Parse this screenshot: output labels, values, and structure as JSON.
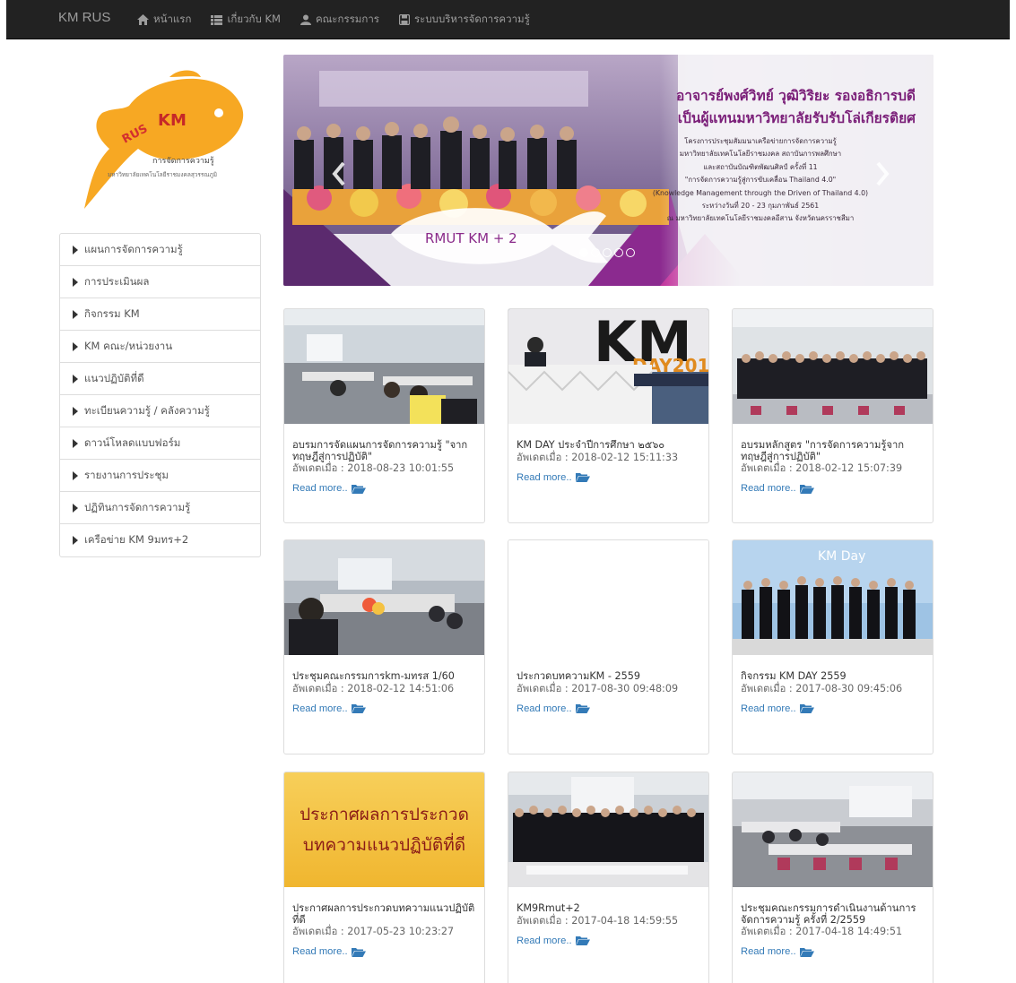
{
  "navbar": {
    "brand": "KM RUS",
    "links": [
      {
        "label": "หน้าแรก",
        "icon": "home-icon"
      },
      {
        "label": "เกี่ยวกับ KM",
        "icon": "list-icon"
      },
      {
        "label": "คณะกรรมการ",
        "icon": "user-icon"
      },
      {
        "label": "ระบบบริหารจัดการความรู้",
        "icon": "disk-icon"
      }
    ]
  },
  "logo": {
    "mark": "RUSKM",
    "title": "การจัดการความรู้",
    "subtitle": "มหาวิทยาลัยเทคโนโลยีราชมงคลสุวรรณภูมิ"
  },
  "sidebar": {
    "items": [
      {
        "label": "แผนการจัดการความรู้"
      },
      {
        "label": "การประเมินผล"
      },
      {
        "label": "กิจกรรม KM"
      },
      {
        "label": "KM คณะ/หน่วยงาน"
      },
      {
        "label": "แนวปฏิบัติที่ดี"
      },
      {
        "label": "ทะเบียนความรู้ / คลังความรู้"
      },
      {
        "label": "ดาวน์โหลดแบบฟอร์ม"
      },
      {
        "label": "รายงานการประชุม"
      },
      {
        "label": "ปฏิทินการจัดการความรู้"
      },
      {
        "label": "เครือข่าย KM 9มทร+2"
      }
    ]
  },
  "carousel": {
    "headline_1": "อาจารย์พงศ์วิทย์ วุฒิวิริยะ รองอธิการบดี",
    "headline_2": "เป็นผู้แทนมหาวิทยาลัยรับรับโล่เกียรติยศ",
    "body_lines": [
      "โครงการประชุมสัมมนาเครือข่ายการจัดการความรู้",
      "มหาวิทยาลัยเทคโนโลยีราชมงคล สถาบันการพลศึกษา",
      "และสถาบันบัณฑิตพัฒนศิลป์ ครั้งที่ 11",
      "\"การจัดการความรู้สู่การขับเคลื่อน Thailand 4.0\"",
      "(Knowledge Management through the Driven of Thailand 4.0)",
      "ระหว่างวันที่ 20 - 23 กุมภาพันธ์ 2561",
      "ณ มหาวิทยาลัยเทคโนโลยีราชมงคลอีสาน จังหวัดนครราชสีมา"
    ],
    "banner_label": "RMUT KM + 2",
    "slide_count": 5,
    "active_slide": 1
  },
  "cards": [
    {
      "title": "อบรมการจัดแผนการจัดการความรู้ \"จากทฤษฎีสู่การปฏิบัติ\"",
      "date": "อัพเดตเมื่อ : 2018-08-23 10:01:55",
      "read_more": "Read more..",
      "image": "meeting-room-photo"
    },
    {
      "title": "KM DAY ประจำปีการศึกษา ๒๕๖๐",
      "date": "อัพเดตเมื่อ : 2018-02-12 15:11:33",
      "read_more": "Read more..",
      "image": "km-day-2018-photo"
    },
    {
      "title": "อบรมหลักสูตร \"การจัดการความรู้จากทฤษฎีสู่การปฏิบัติ\"",
      "date": "อัพเดตเมื่อ : 2018-02-12 15:07:39",
      "read_more": "Read more..",
      "image": "group-photo"
    },
    {
      "title": "ประชุมคณะกรรมการkm-มทรส 1/60",
      "date": "อัพเดตเมื่อ : 2018-02-12 14:51:06",
      "read_more": "Read more..",
      "image": "meeting-photo"
    },
    {
      "title": "ประกวดบทความKM - 2559",
      "date": "อัพเดตเมื่อ : 2017-08-30 09:48:09",
      "read_more": "Read more..",
      "image": ""
    },
    {
      "title": "กิจกรรม KM DAY 2559",
      "date": "อัพเดตเมื่อ : 2017-08-30 09:45:06",
      "read_more": "Read more..",
      "image": "km-day-group-photo"
    },
    {
      "title": "ประกาศผลการประกวดบทความแนวปฏิบัติที่ดี",
      "date": "อัพเดตเมื่อ : 2017-05-23 10:23:27",
      "read_more": "Read more..",
      "image": "announcement-banner",
      "banner_text_1": "ประกาศผลการประกวด",
      "banner_text_2": "บทความแนวปฏิบัติที่ดี"
    },
    {
      "title": "KM9Rmut+2",
      "date": "อัพเดตเมื่อ : 2017-04-18 14:59:55",
      "read_more": "Read more..",
      "image": "conference-group-photo"
    },
    {
      "title": "ประชุมคณะกรรมการดำเนินงานด้านการจัดการความรู้ ครั้งที่ 2/2559",
      "date": "อัพเดตเมื่อ : 2017-04-18 14:49:51",
      "read_more": "Read more..",
      "image": "classroom-photo"
    }
  ],
  "colors": {
    "navbar_bg": "#222222",
    "link": "#337ab7",
    "logo_fish": "#f7a823",
    "headline": "#7a1e78"
  }
}
